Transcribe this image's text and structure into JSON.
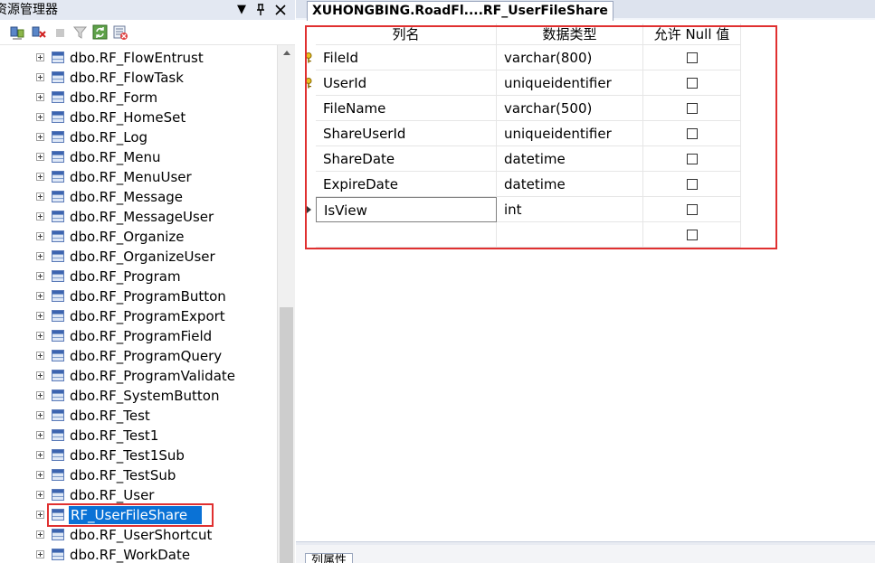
{
  "object_explorer": {
    "title": "资源管理器",
    "title_buttons": {
      "dropdown": "▼",
      "pin": "📌",
      "close": "✕"
    },
    "toolbar_icons": [
      "connect-icon",
      "disconnect-icon",
      "stop-icon",
      "filter-icon",
      "refresh-icon",
      "summary-icon"
    ],
    "tree_items": [
      {
        "label": "dbo.RF_FlowEntrust",
        "selected": false
      },
      {
        "label": "dbo.RF_FlowTask",
        "selected": false
      },
      {
        "label": "dbo.RF_Form",
        "selected": false
      },
      {
        "label": "dbo.RF_HomeSet",
        "selected": false
      },
      {
        "label": "dbo.RF_Log",
        "selected": false
      },
      {
        "label": "dbo.RF_Menu",
        "selected": false
      },
      {
        "label": "dbo.RF_MenuUser",
        "selected": false
      },
      {
        "label": "dbo.RF_Message",
        "selected": false
      },
      {
        "label": "dbo.RF_MessageUser",
        "selected": false
      },
      {
        "label": "dbo.RF_Organize",
        "selected": false
      },
      {
        "label": "dbo.RF_OrganizeUser",
        "selected": false
      },
      {
        "label": "dbo.RF_Program",
        "selected": false
      },
      {
        "label": "dbo.RF_ProgramButton",
        "selected": false
      },
      {
        "label": "dbo.RF_ProgramExport",
        "selected": false
      },
      {
        "label": "dbo.RF_ProgramField",
        "selected": false
      },
      {
        "label": "dbo.RF_ProgramQuery",
        "selected": false
      },
      {
        "label": "dbo.RF_ProgramValidate",
        "selected": false
      },
      {
        "label": "dbo.RF_SystemButton",
        "selected": false
      },
      {
        "label": "dbo.RF_Test",
        "selected": false
      },
      {
        "label": "dbo.RF_Test1",
        "selected": false
      },
      {
        "label": "dbo.RF_Test1Sub",
        "selected": false
      },
      {
        "label": "dbo.RF_TestSub",
        "selected": false
      },
      {
        "label": "dbo.RF_User",
        "selected": false
      },
      {
        "label": "RF_UserFileShare",
        "selected": true
      },
      {
        "label": "dbo.RF_UserShortcut",
        "selected": false
      },
      {
        "label": "dbo.RF_WorkDate",
        "selected": false
      }
    ]
  },
  "designer": {
    "tab_title": "XUHONGBING.RoadFl....RF_UserFileShare",
    "columns_header": {
      "name": "列名",
      "type": "数据类型",
      "nullable": "允许 Null 值"
    },
    "columns": [
      {
        "name": "FileId",
        "type": "varchar(800)",
        "allow_null": false,
        "primary_key": true
      },
      {
        "name": "UserId",
        "type": "uniqueidentifier",
        "allow_null": false,
        "primary_key": true
      },
      {
        "name": "FileName",
        "type": "varchar(500)",
        "allow_null": false,
        "primary_key": false
      },
      {
        "name": "ShareUserId",
        "type": "uniqueidentifier",
        "allow_null": false,
        "primary_key": false
      },
      {
        "name": "ShareDate",
        "type": "datetime",
        "allow_null": false,
        "primary_key": false
      },
      {
        "name": "ExpireDate",
        "type": "datetime",
        "allow_null": false,
        "primary_key": false
      },
      {
        "name": "IsView",
        "type": "int",
        "allow_null": false,
        "primary_key": false,
        "editing": true
      },
      {
        "name": "",
        "type": "",
        "allow_null": false,
        "primary_key": false
      }
    ],
    "properties_tab": "列属性"
  },
  "colors": {
    "highlight_box": "#e03030",
    "selection": "#0a72d6",
    "panel_bg": "#e3e8f2"
  }
}
